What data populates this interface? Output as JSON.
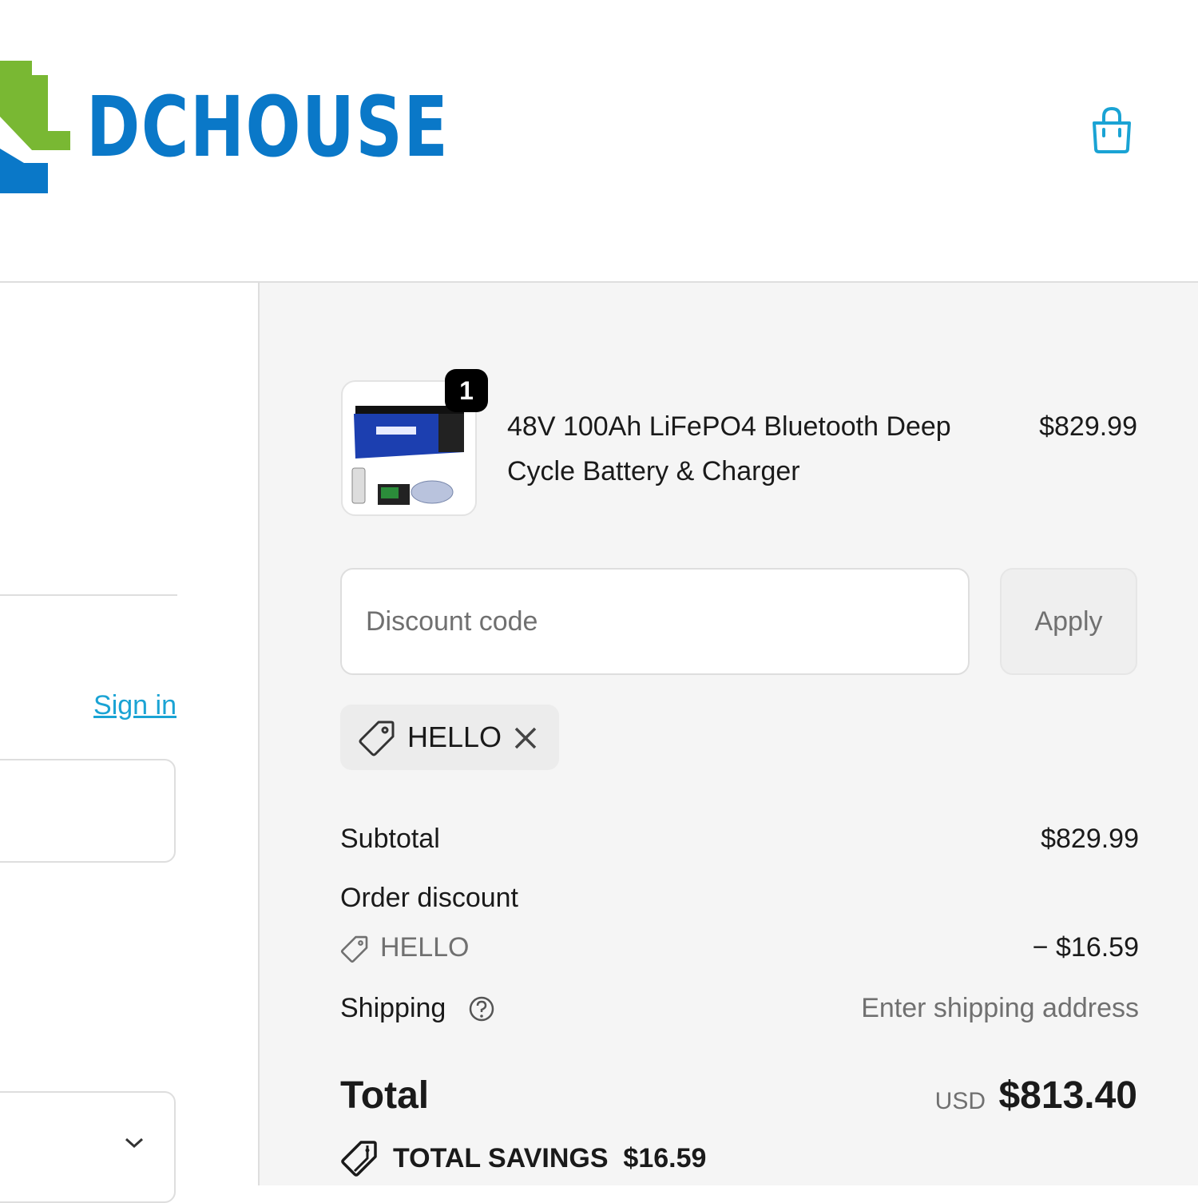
{
  "header": {
    "logo_text": "DCHOUSE",
    "cart_icon": "shopping-bag-icon",
    "accent_color": "#1aa3d4"
  },
  "left": {
    "sign_in_link": "Sign in"
  },
  "summary": {
    "item": {
      "name": "48V 100Ah LiFePO4 Bluetooth Deep Cycle Battery & Charger",
      "price": "$829.99",
      "quantity": "1"
    },
    "discount_input": {
      "placeholder": "Discount code",
      "value": ""
    },
    "apply_label": "Apply",
    "applied_code": "HELLO",
    "subtotal_label": "Subtotal",
    "subtotal_value": "$829.99",
    "order_discount_label": "Order discount",
    "order_discount_code": "HELLO",
    "order_discount_value": "− $16.59",
    "shipping_label": "Shipping",
    "shipping_value": "Enter shipping address",
    "total_label": "Total",
    "currency": "USD",
    "total_value": "$813.40",
    "savings_label": "TOTAL SAVINGS",
    "savings_value": "$16.59"
  }
}
